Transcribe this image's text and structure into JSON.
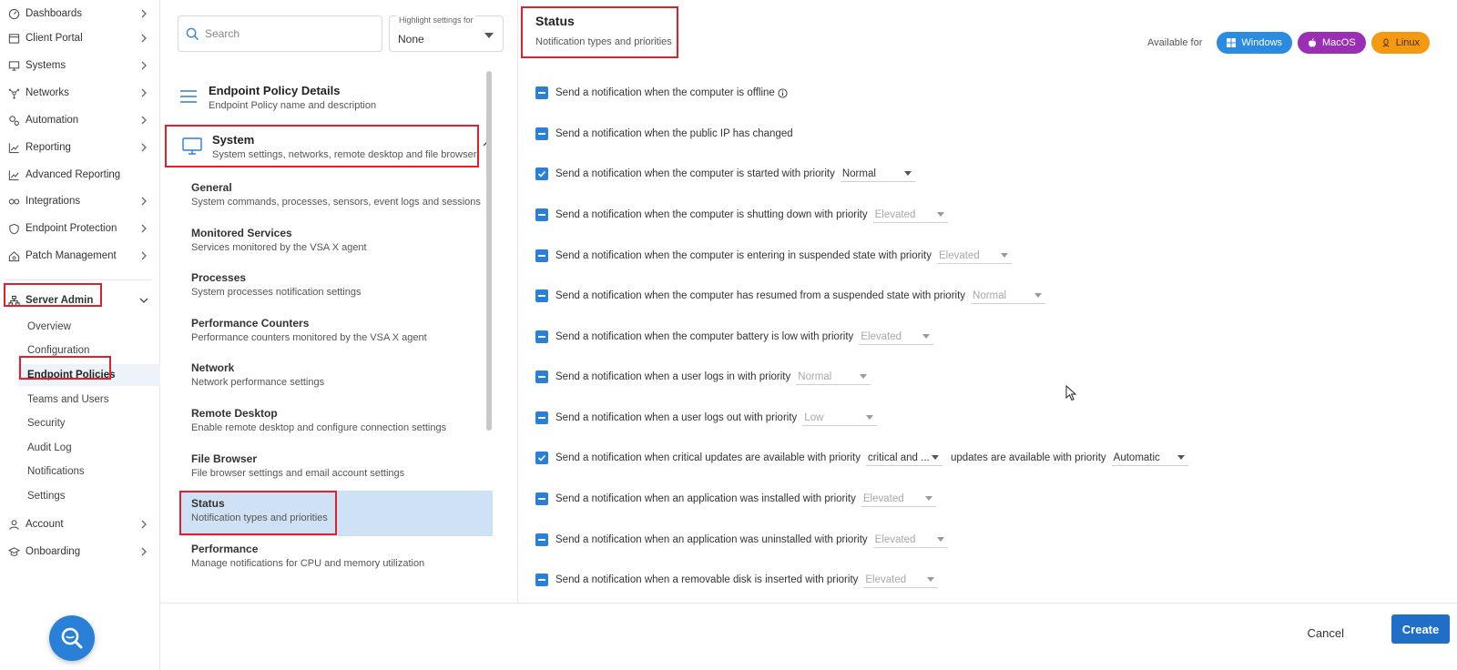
{
  "nav": {
    "items": [
      {
        "label": "Dashboards",
        "icon": "dashboard-icon"
      },
      {
        "label": "Client Portal",
        "icon": "window-icon"
      },
      {
        "label": "Systems",
        "icon": "monitor-icon"
      },
      {
        "label": "Networks",
        "icon": "network-icon"
      },
      {
        "label": "Automation",
        "icon": "gears-icon"
      },
      {
        "label": "Reporting",
        "icon": "chart-icon"
      },
      {
        "label": "Advanced Reporting",
        "icon": "chart-icon"
      },
      {
        "label": "Integrations",
        "icon": "infinity-icon"
      },
      {
        "label": "Endpoint Protection",
        "icon": "shield-icon"
      },
      {
        "label": "Patch Management",
        "icon": "home-gear-icon"
      }
    ],
    "server_admin": {
      "label": "Server Admin",
      "subitems": [
        "Overview",
        "Configuration",
        "Endpoint Policies",
        "Teams and Users",
        "Security",
        "Audit Log",
        "Notifications",
        "Settings"
      ],
      "active": "Endpoint Policies"
    },
    "bottom_items": [
      {
        "label": "Account",
        "icon": "user-icon"
      },
      {
        "label": "Onboarding",
        "icon": "graduation-icon"
      }
    ]
  },
  "middle": {
    "search_placeholder": "Search",
    "highlight_label": "Highlight settings for",
    "highlight_value": "None",
    "policy_details": {
      "title": "Endpoint Policy Details",
      "desc": "Endpoint Policy name and description"
    },
    "system": {
      "title": "System",
      "desc": "System settings, networks, remote desktop and file browser"
    },
    "categories": [
      {
        "title": "General",
        "desc": "System commands, processes, sensors, event logs and sessions"
      },
      {
        "title": "Monitored Services",
        "desc": "Services monitored by the VSA X agent"
      },
      {
        "title": "Processes",
        "desc": "System processes notification settings"
      },
      {
        "title": "Performance Counters",
        "desc": "Performance counters monitored by the VSA X agent"
      },
      {
        "title": "Network",
        "desc": "Network performance settings"
      },
      {
        "title": "Remote Desktop",
        "desc": "Enable remote desktop and configure connection settings"
      },
      {
        "title": "File Browser",
        "desc": "File browser settings and email account settings"
      },
      {
        "title": "Status",
        "desc": "Notification types and priorities"
      },
      {
        "title": "Performance",
        "desc": "Manage notifications for CPU and memory utilization"
      }
    ]
  },
  "content": {
    "title": "Status",
    "subtitle": "Notification types and priorities",
    "available_label": "Available for",
    "platforms": [
      {
        "label": "Windows",
        "color": "#2a8be0"
      },
      {
        "label": "MacOS",
        "color": "#9a2fb5"
      },
      {
        "label": "Linux",
        "color": "#f39a12"
      }
    ],
    "rows": [
      {
        "state": "partial",
        "text": "Send a notification when the computer is offline",
        "info": true
      },
      {
        "state": "partial",
        "text": "Send a notification when the public IP has changed"
      },
      {
        "state": "checked",
        "text": "Send a notification when the computer is started with priority",
        "select": "Normal",
        "disabled": false
      },
      {
        "state": "partial",
        "text": "Send a notification when the computer is shutting down with priority",
        "select": "Elevated",
        "disabled": true
      },
      {
        "state": "partial",
        "text": "Send a notification when the computer is entering in suspended state with priority",
        "select": "Elevated",
        "disabled": true
      },
      {
        "state": "partial",
        "text": "Send a notification when the computer has resumed from a suspended state with priority",
        "select": "Normal",
        "disabled": true
      },
      {
        "state": "partial",
        "text": "Send a notification when the computer battery is low with priority",
        "select": "Elevated",
        "disabled": true
      },
      {
        "state": "partial",
        "text": "Send a notification when a user logs in with priority",
        "select": "Normal",
        "disabled": true
      },
      {
        "state": "partial",
        "text": "Send a notification when a user logs out with priority",
        "select": "Low",
        "disabled": true
      },
      {
        "state": "checked",
        "text": "Send a notification when critical updates are available with priority",
        "select": "critical and ...",
        "disabled": false,
        "extra_text": "updates are available with priority",
        "extra_select": "Automatic"
      },
      {
        "state": "partial",
        "text": "Send a notification when an application was installed with priority",
        "select": "Elevated",
        "disabled": true
      },
      {
        "state": "partial",
        "text": "Send a notification when an application was uninstalled with priority",
        "select": "Elevated",
        "disabled": true
      },
      {
        "state": "partial",
        "text": "Send a notification when a removable disk is inserted with priority",
        "select": "Elevated",
        "disabled": true
      }
    ]
  },
  "footer": {
    "cancel": "Cancel",
    "create": "Create"
  }
}
